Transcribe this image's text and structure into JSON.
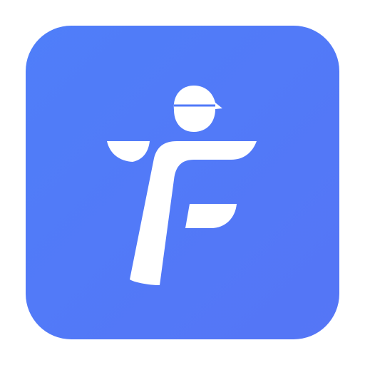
{
  "app_icon": {
    "name": "app-logo-icon",
    "glyph": "stylized-letter-f-person-with-cap",
    "background_color_start": "#4f7ef9",
    "background_color_end": "#5575f6",
    "glyph_color": "#ffffff"
  }
}
